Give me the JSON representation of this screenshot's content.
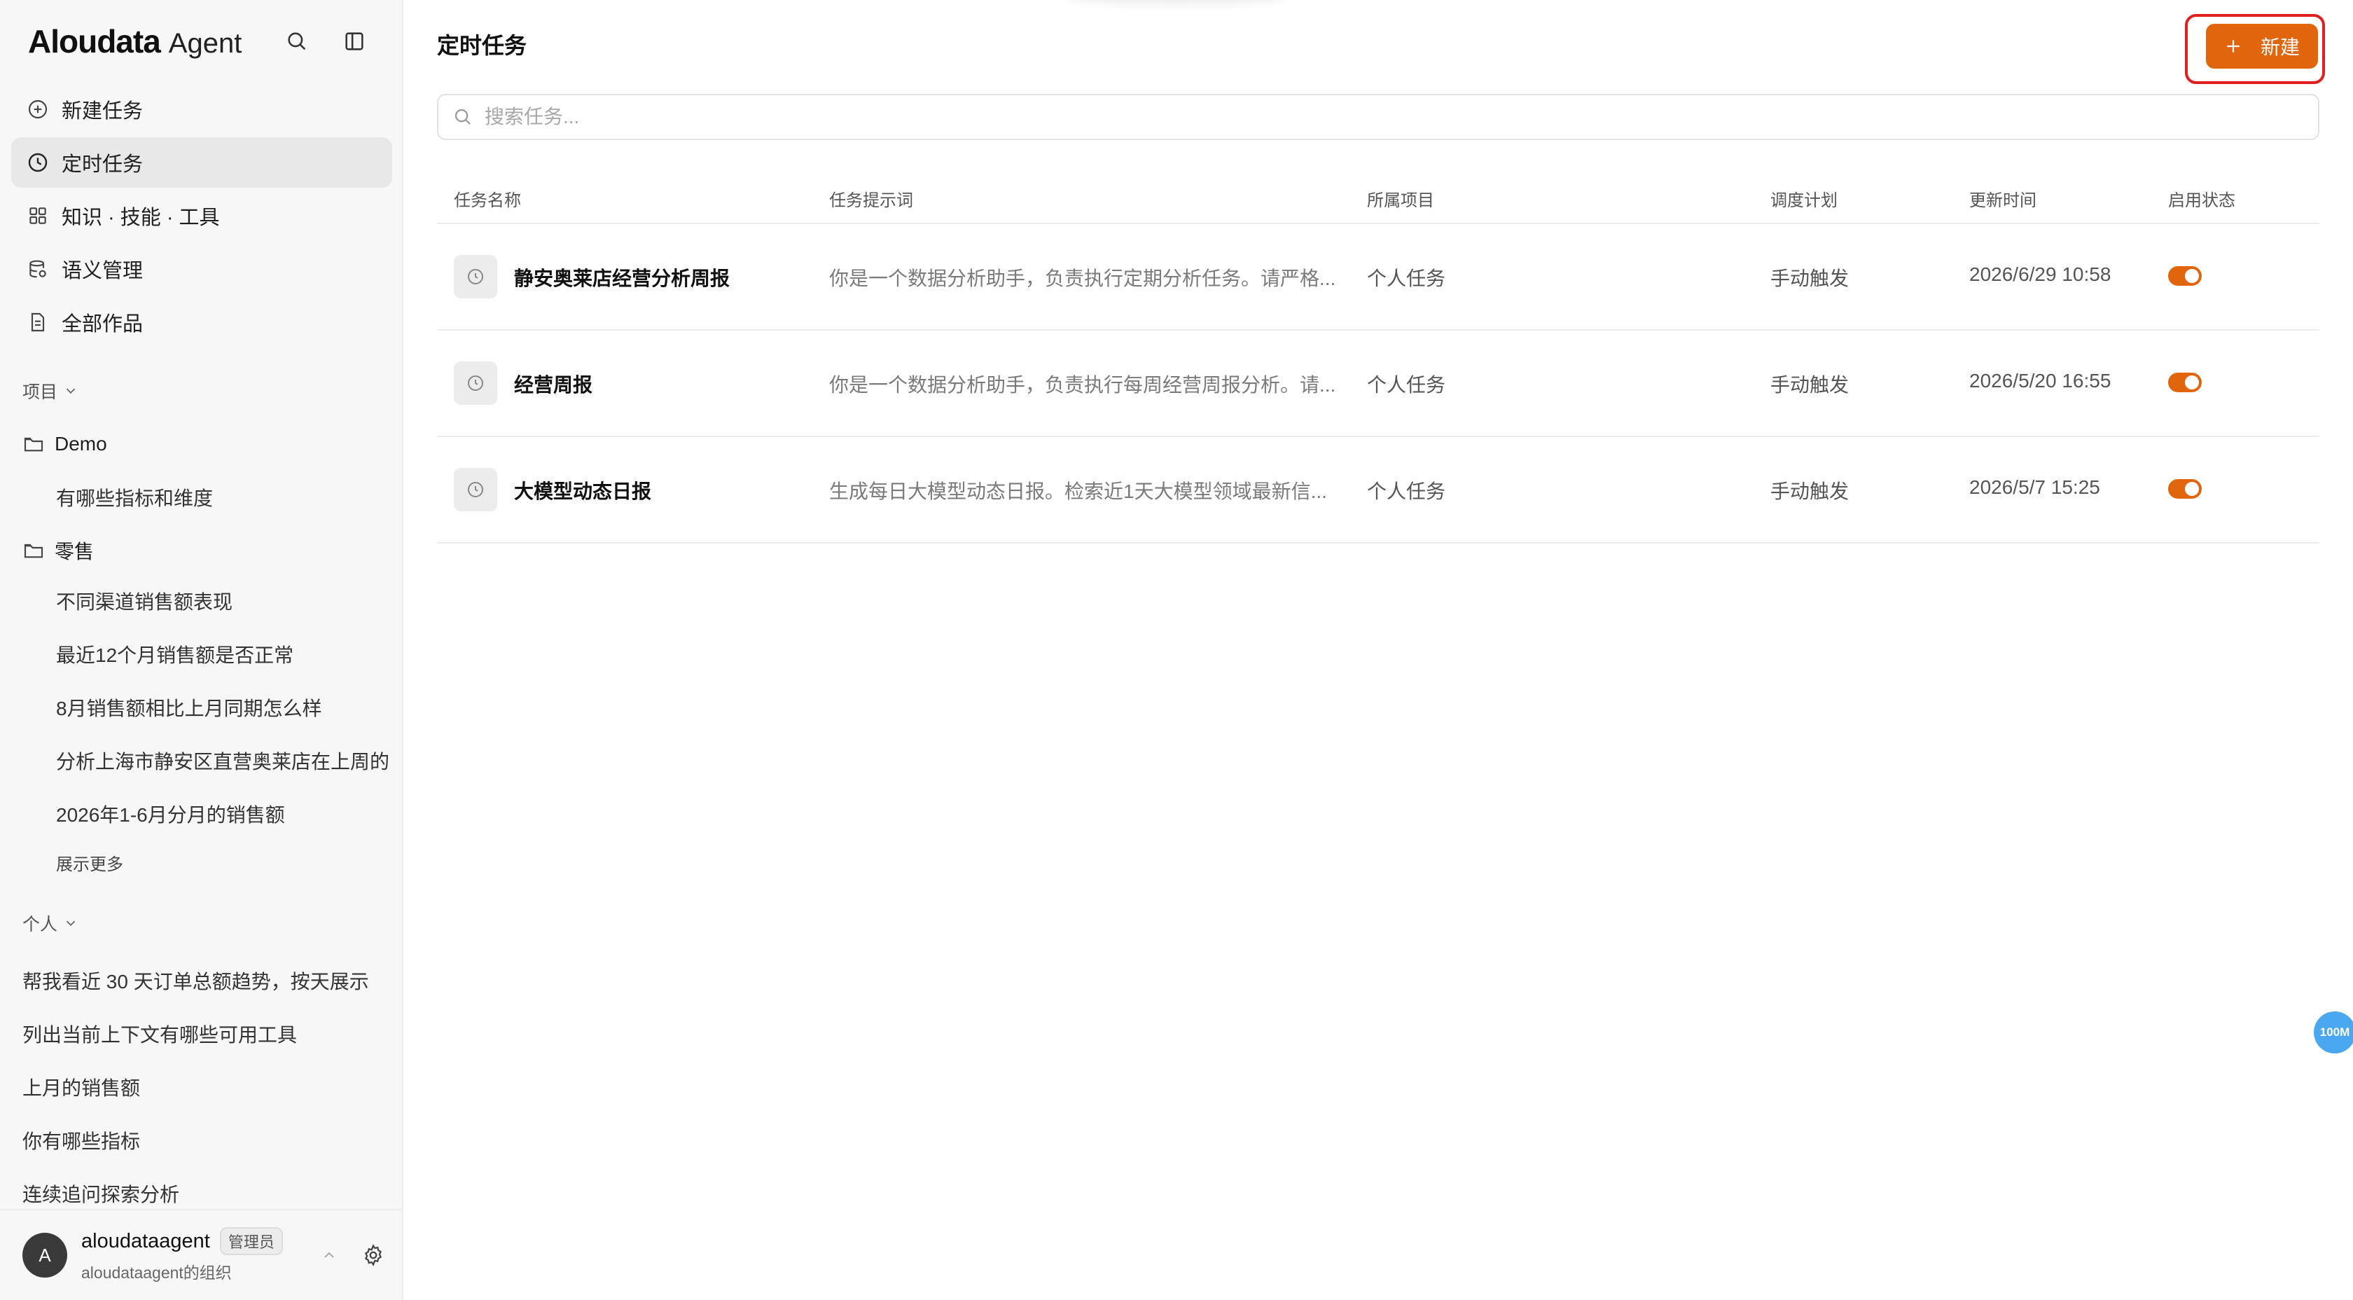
{
  "app": {
    "logo_main": "Aloudata",
    "logo_sub": "Agent"
  },
  "sidebar": {
    "nav": [
      {
        "label": "新建任务",
        "icon": "plus-icon"
      },
      {
        "label": "定时任务",
        "icon": "clock-icon",
        "active": true
      },
      {
        "label": "知识 · 技能 · 工具",
        "icon": "grid-icon"
      },
      {
        "label": "语义管理",
        "icon": "database-icon"
      },
      {
        "label": "全部作品",
        "icon": "document-icon"
      }
    ],
    "projects_label": "项目",
    "folders": [
      {
        "name": "Demo",
        "items": [
          "有哪些指标和维度"
        ]
      },
      {
        "name": "零售",
        "items": [
          "不同渠道销售额表现",
          "最近12个月销售额是否正常",
          "8月销售额相比上月同期怎么样",
          "分析上海市静安区直营奥莱店在上周的",
          "2026年1-6月分月的销售额"
        ]
      }
    ],
    "show_more": "展示更多",
    "personal_label": "个人",
    "personal_items": [
      "帮我看近 30 天订单总额趋势，按天展示",
      "列出当前上下文有哪些可用工具",
      "上月的销售额",
      "你有哪些指标",
      "连续追问探索分析"
    ],
    "user": {
      "avatar_letter": "A",
      "name": "aloudataagent",
      "role": "管理员",
      "org": "aloudataagent的组织"
    }
  },
  "main": {
    "title": "定时任务",
    "new_button": "新建",
    "search_placeholder": "搜索任务...",
    "columns": [
      "任务名称",
      "任务提示词",
      "所属项目",
      "调度计划",
      "更新时间",
      "启用状态"
    ],
    "rows": [
      {
        "name": "静安奥莱店经营分析周报",
        "prompt": "你是一个数据分析助手，负责执行定期分析任务。请严格...",
        "project": "个人任务",
        "schedule": "手动触发",
        "updated": "2026/6/29 10:58",
        "enabled": true
      },
      {
        "name": "经营周报",
        "prompt": "你是一个数据分析助手，负责执行每周经营周报分析。请...",
        "project": "个人任务",
        "schedule": "手动触发",
        "updated": "2026/5/20 16:55",
        "enabled": true
      },
      {
        "name": "大模型动态日报",
        "prompt": "生成每日大模型动态日报。检索近1天大模型领域最新信...",
        "project": "个人任务",
        "schedule": "手动触发",
        "updated": "2026/5/7 15:25",
        "enabled": true
      }
    ],
    "memory_badge": "100M"
  },
  "colors": {
    "accent": "#e0650c",
    "highlight": "#e02020",
    "sidebar_bg": "#f7f7f7",
    "active_bg": "#e8e8e8",
    "badge": "#4aa8f0"
  }
}
